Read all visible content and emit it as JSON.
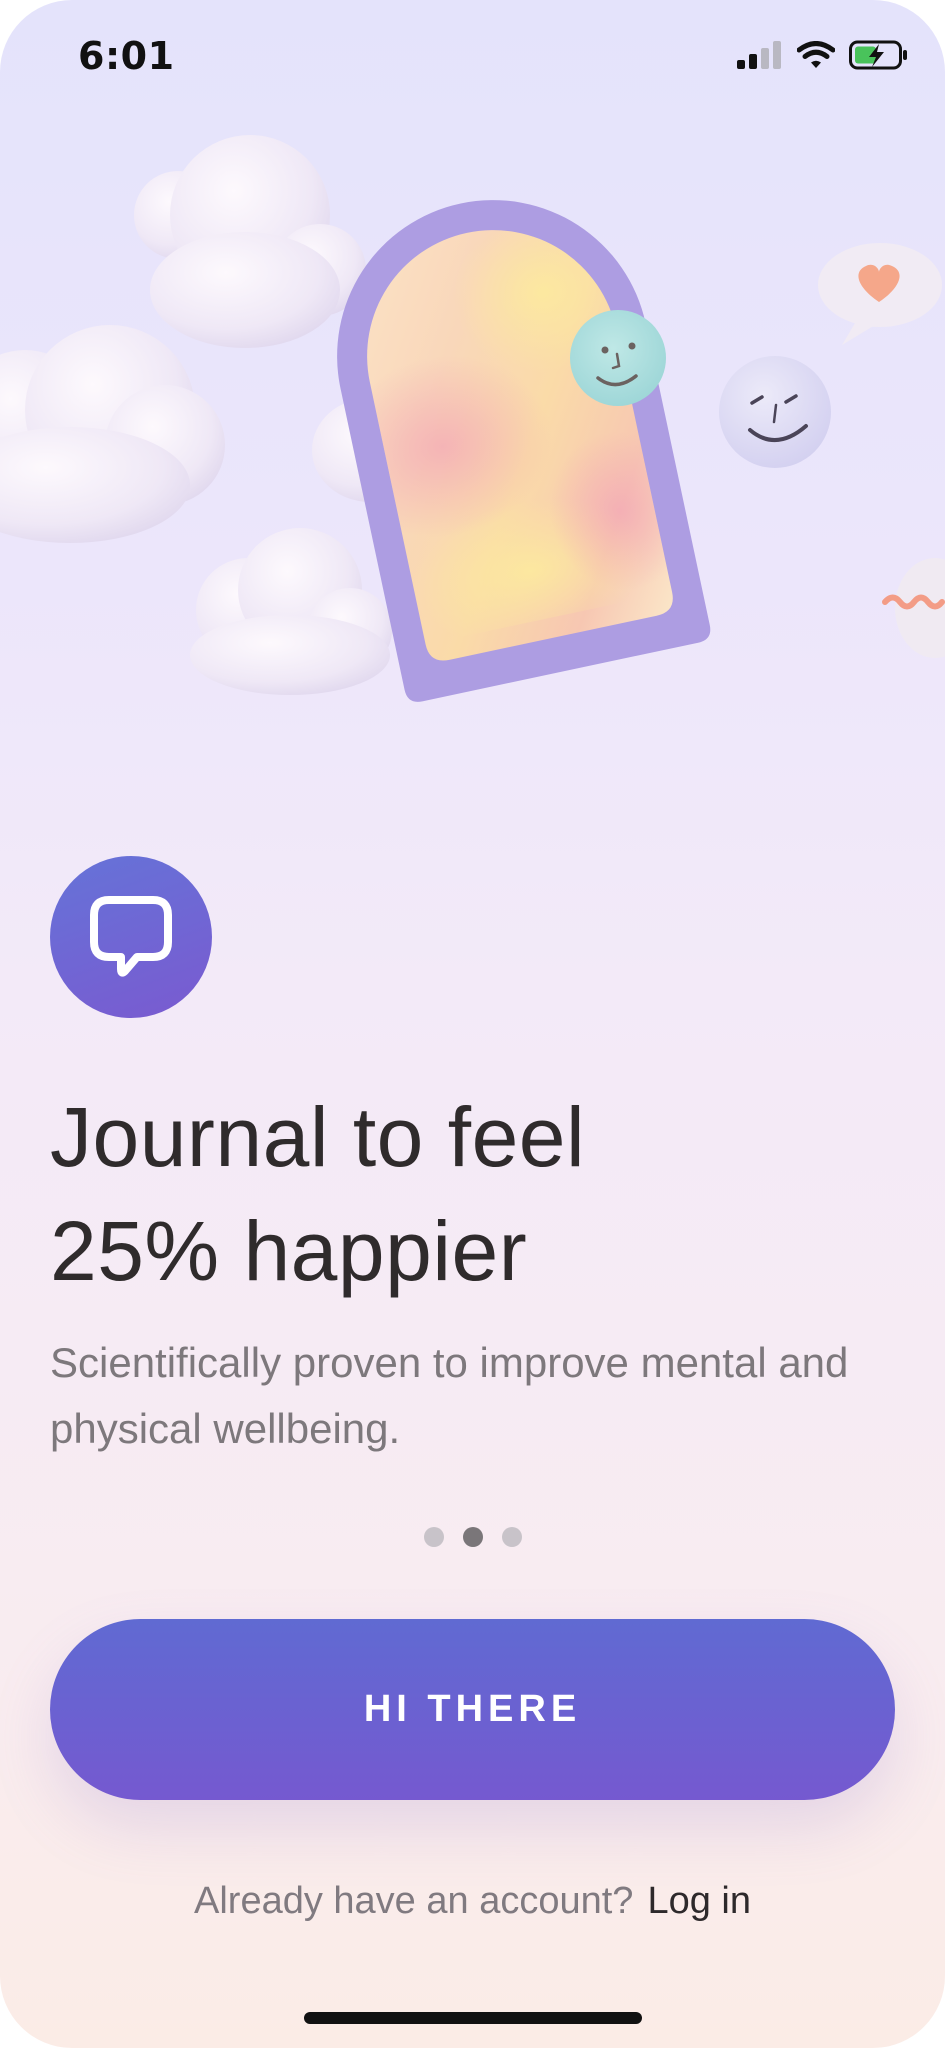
{
  "status_bar": {
    "time": "6:01",
    "icons": [
      "cellular-signal-icon",
      "wifi-icon",
      "battery-charging-icon"
    ]
  },
  "hero": {
    "illustration": [
      "cloud-icon",
      "arch-mirror-icon",
      "smiley-face-icon",
      "heart-bubble-icon"
    ]
  },
  "brand": {
    "logo_icon": "chat-bubble-icon",
    "colors": {
      "accent_start": "#606ad2",
      "accent_end": "#7559d0"
    }
  },
  "onboarding": {
    "headline_line1": "Journal to feel",
    "headline_line2": "25% happier",
    "subtitle": "Scientifically proven to improve mental and physical wellbeing.",
    "page_count": 3,
    "active_page": 2
  },
  "actions": {
    "primary_label": "HI THERE",
    "login_prompt": "Already have an account?",
    "login_link": "Log in"
  }
}
